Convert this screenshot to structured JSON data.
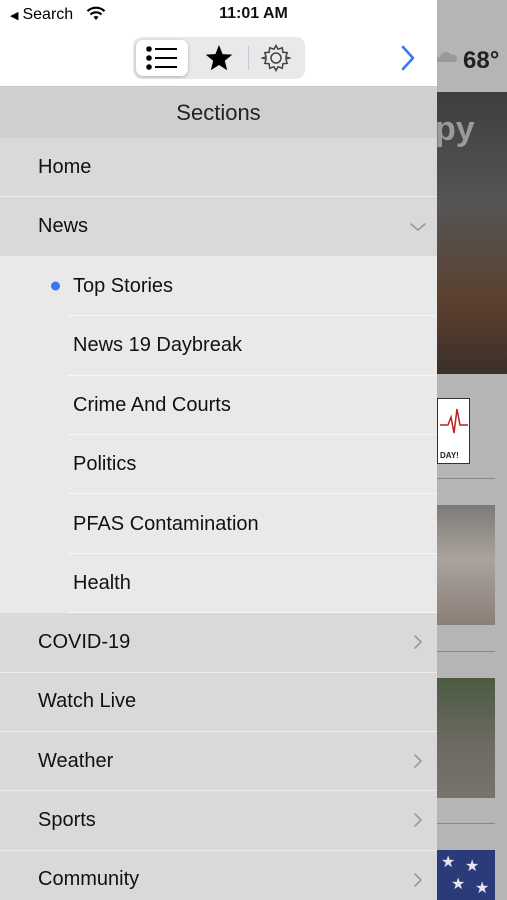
{
  "status_bar": {
    "back_label": "Search",
    "time": "11:01 AM"
  },
  "toolbar": {
    "segments": [
      {
        "icon": "list-icon",
        "selected": true
      },
      {
        "icon": "star-icon",
        "selected": false
      },
      {
        "icon": "gear-icon",
        "selected": false
      }
    ],
    "forward_icon": "chevron-right-icon",
    "accent_color": "#3478f6"
  },
  "sections": {
    "title": "Sections",
    "items": [
      {
        "label": "Home",
        "level": 0
      },
      {
        "label": "News",
        "level": 0,
        "expanded": true
      },
      {
        "label": "Top Stories",
        "level": 1,
        "selected": true
      },
      {
        "label": "News 19 Daybreak",
        "level": 1
      },
      {
        "label": "Crime And Courts",
        "level": 1
      },
      {
        "label": "Politics",
        "level": 1
      },
      {
        "label": "PFAS Contamination",
        "level": 1
      },
      {
        "label": "Health",
        "level": 1
      },
      {
        "label": "COVID-19",
        "level": 0,
        "has_children": true
      },
      {
        "label": "Watch Live",
        "level": 0
      },
      {
        "label": "Weather",
        "level": 0,
        "has_children": true
      },
      {
        "label": "Sports",
        "level": 0,
        "has_children": true
      },
      {
        "label": "Community",
        "level": 0,
        "has_children": true
      }
    ]
  },
  "background": {
    "temperature": "68°",
    "hero_text": "py",
    "thumb_caption": "DAY!"
  }
}
